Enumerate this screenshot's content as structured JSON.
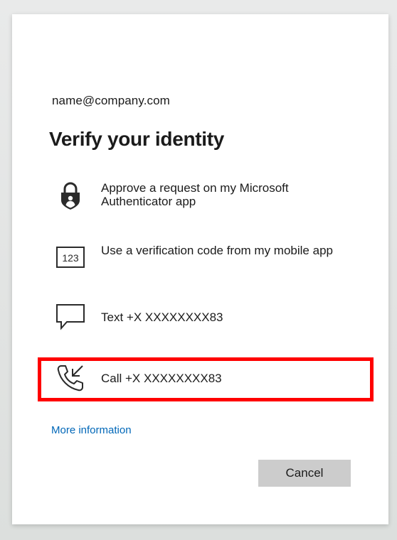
{
  "account": {
    "email": "name@company.com"
  },
  "dialog": {
    "title": "Verify your identity"
  },
  "options": [
    {
      "label": "Approve a request on my Microsoft Authenticator app",
      "icon": "authenticator-lock-icon"
    },
    {
      "label": "Use a verification code from my mobile app",
      "icon": "verification-code-icon",
      "icon_text": "123"
    },
    {
      "label": "Text +X XXXXXXXX83",
      "icon": "message-icon"
    },
    {
      "label": "Call +X XXXXXXXX83",
      "icon": "phone-call-icon"
    }
  ],
  "links": {
    "more_information": "More information"
  },
  "buttons": {
    "cancel": "Cancel"
  },
  "colors": {
    "link": "#0067b8",
    "highlight": "#ff0000",
    "cancel_bg": "#cccccc"
  }
}
